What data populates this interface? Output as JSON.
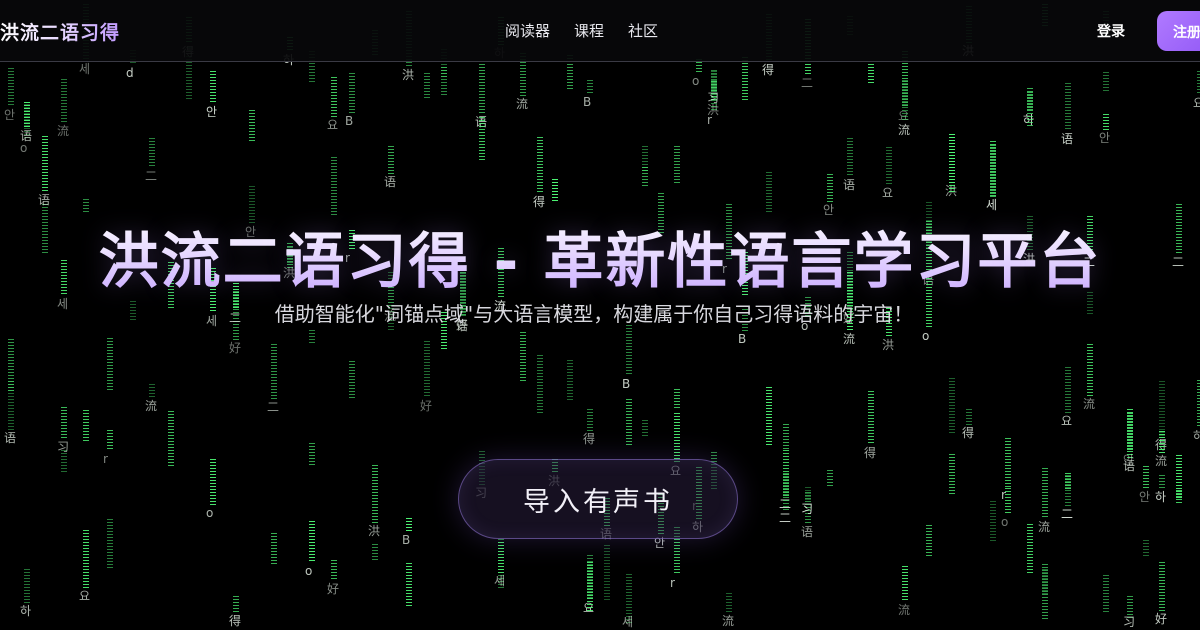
{
  "brand": {
    "logo_text": "洪流二语习得"
  },
  "nav": {
    "links": [
      "阅读器",
      "课程",
      "社区"
    ],
    "login_label": "登录",
    "register_label": "注册"
  },
  "hero": {
    "title": "洪流二语习得 - 革新性语言学习平台",
    "subtitle": "借助智能化\"词锚点域\"与大语言模型，构建属于你自己习得语料的宇宙！",
    "import_button_label": "导入有声书"
  },
  "background": {
    "rain_glyphs": [
      "洪",
      "流",
      "二",
      "语",
      "习",
      "得",
      "세",
      "안",
      "하",
      "요",
      "好",
      "B",
      "d",
      "r",
      "o"
    ],
    "rain_color": "#50ff78"
  },
  "colors": {
    "accent": "#a06bff",
    "register_button": "#9a62f7",
    "title_gradient_end": "#c8a8ff"
  }
}
